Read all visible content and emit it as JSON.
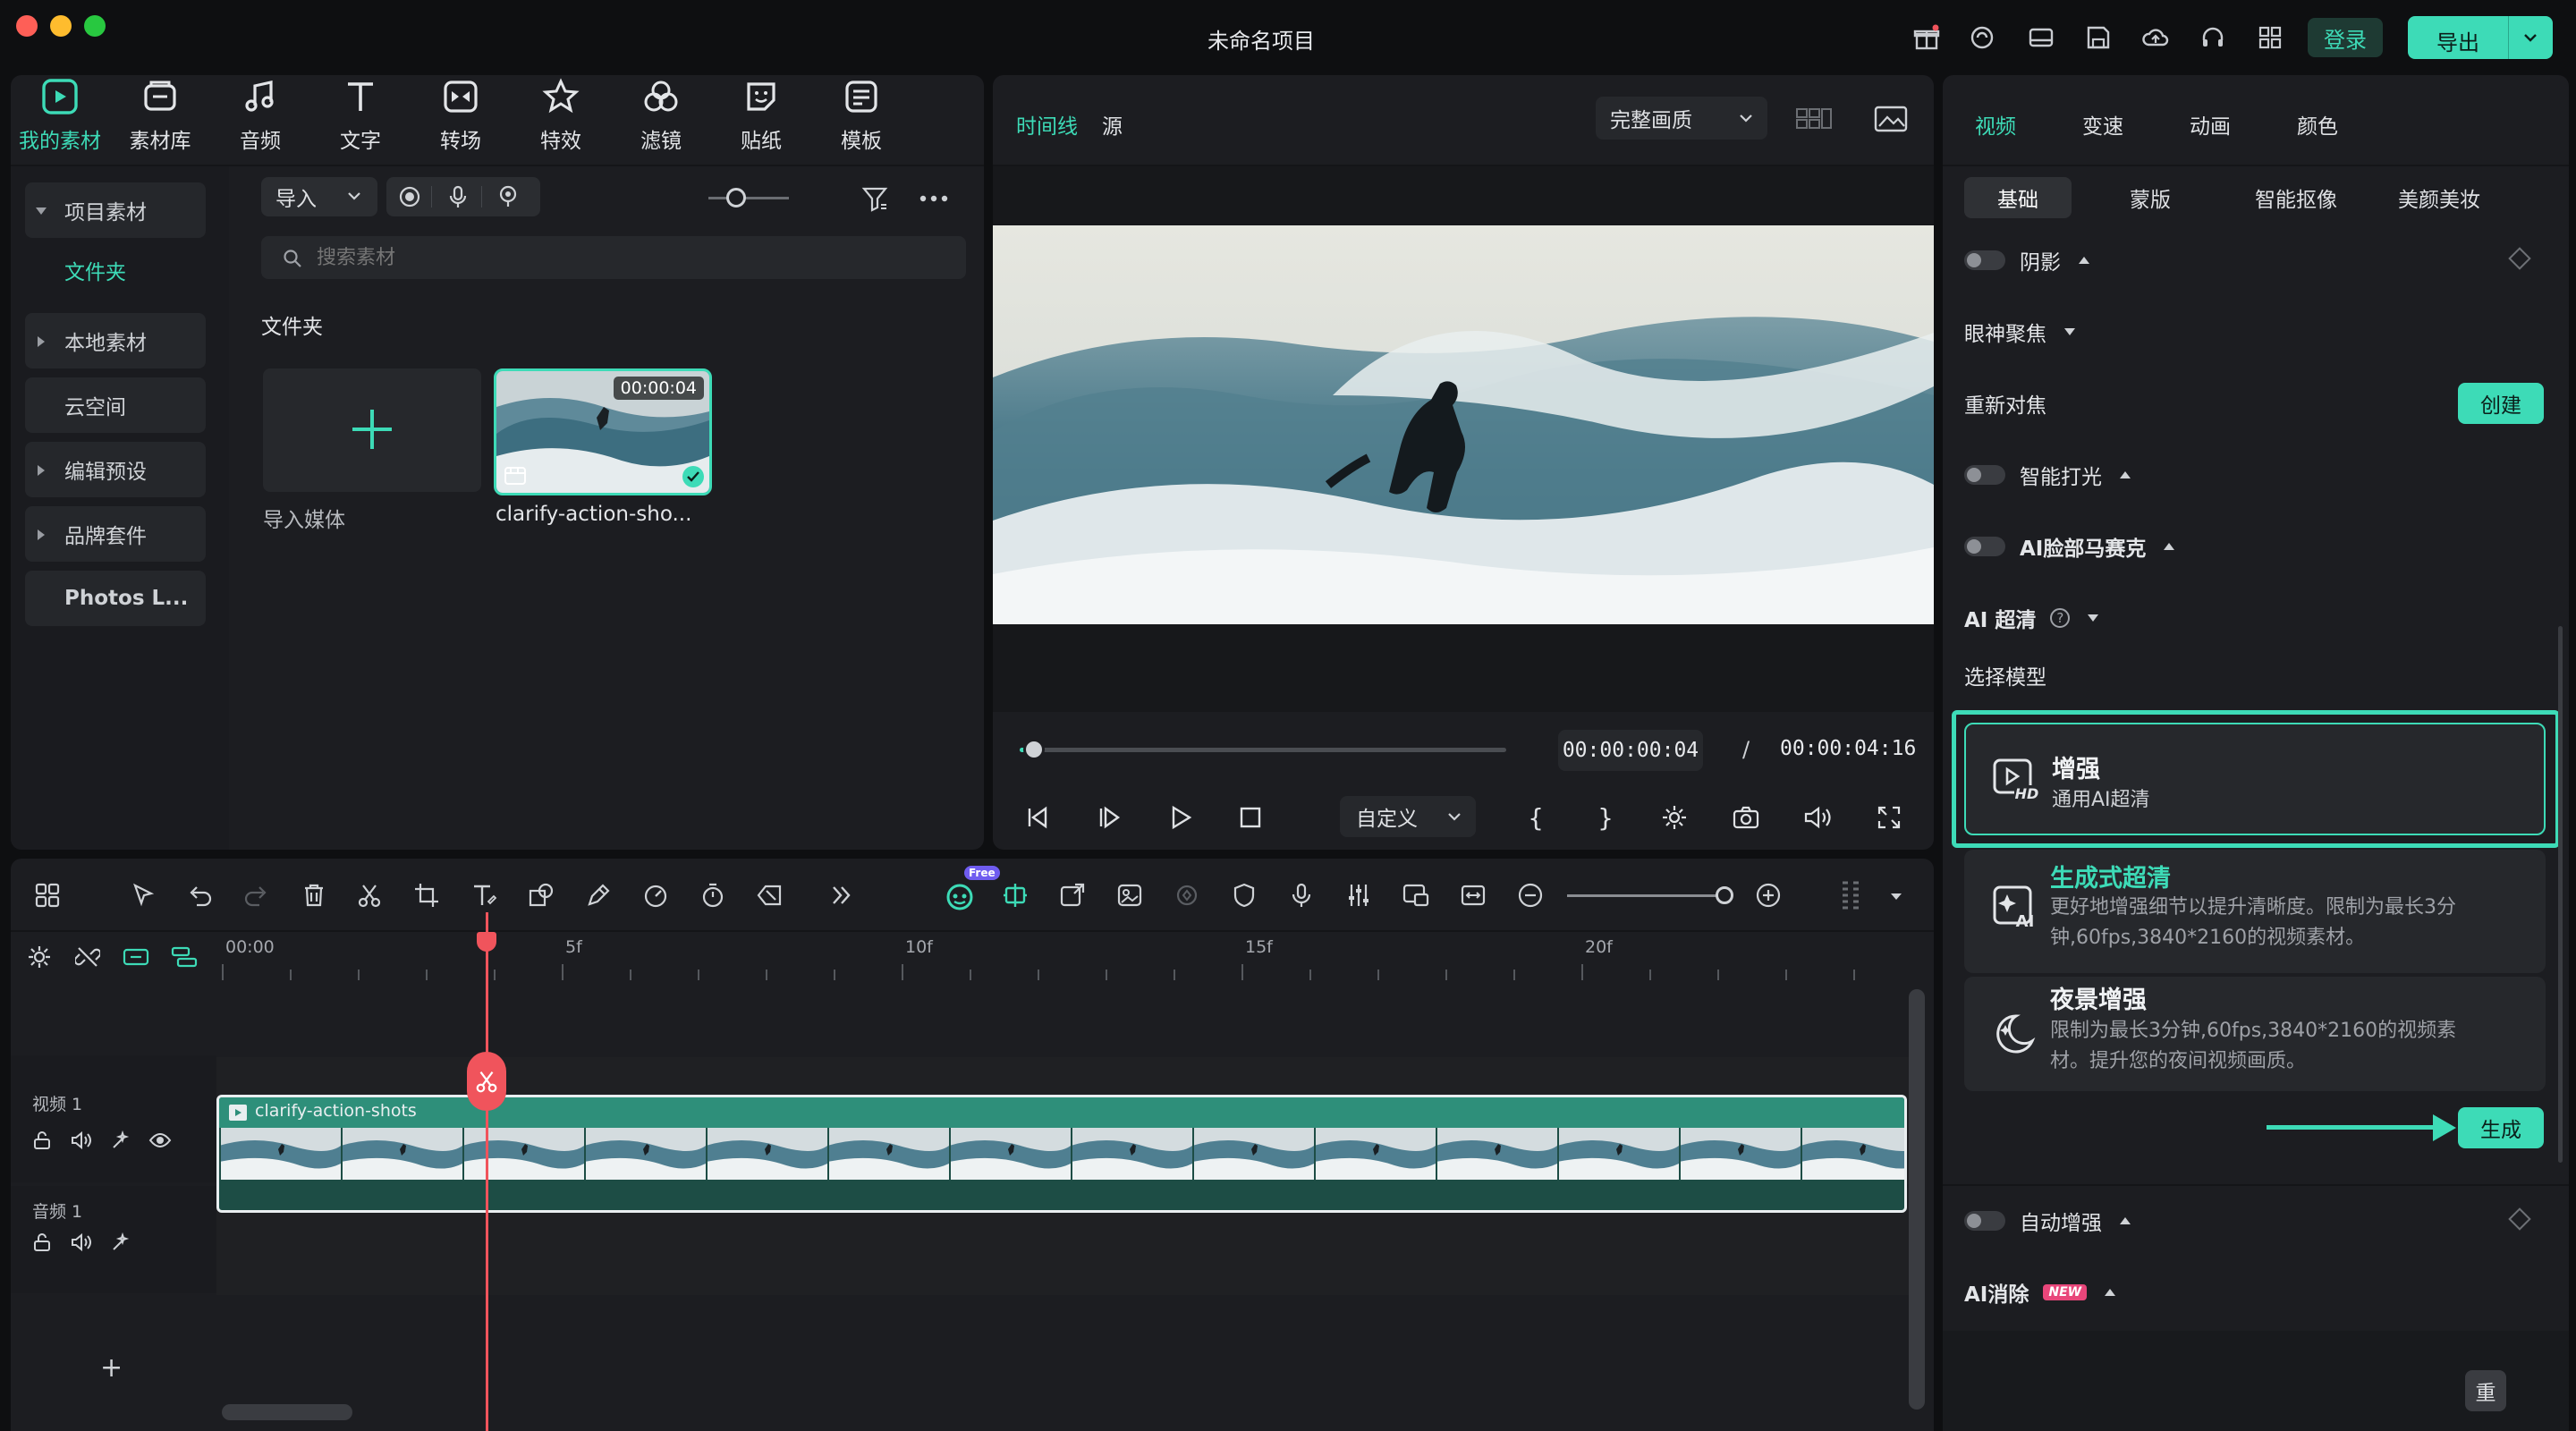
{
  "window": {
    "title": "未命名项目"
  },
  "titlebar": {
    "login_label": "登录",
    "export_label": "导出"
  },
  "nav": [
    {
      "label": "我的素材",
      "icon": "media-icon",
      "active": true
    },
    {
      "label": "素材库",
      "icon": "stock-library-icon"
    },
    {
      "label": "音频",
      "icon": "music-note-icon"
    },
    {
      "label": "文字",
      "icon": "text-t-icon"
    },
    {
      "label": "转场",
      "icon": "transition-icon"
    },
    {
      "label": "特效",
      "icon": "effects-star-icon"
    },
    {
      "label": "滤镜",
      "icon": "filter-icon"
    },
    {
      "label": "贴纸",
      "icon": "sticker-icon"
    },
    {
      "label": "模板",
      "icon": "template-icon"
    }
  ],
  "sidebar": {
    "items": [
      {
        "label": "项目素材",
        "expanded": true
      },
      {
        "label": "文件夹",
        "active": true
      },
      {
        "label": "本地素材"
      },
      {
        "label": "云空间"
      },
      {
        "label": "编辑预设"
      },
      {
        "label": "品牌套件"
      },
      {
        "label": "Photos L..."
      }
    ]
  },
  "library": {
    "import_label": "导入",
    "search_placeholder": "搜索素材",
    "folder_heading": "文件夹",
    "import_media_label": "导入媒体",
    "clip": {
      "name": "clarify-action-sho...",
      "duration": "00:00:04"
    }
  },
  "player": {
    "tab_timeline": "时间线",
    "tab_source": "源",
    "quality_label": "完整画质",
    "current_time": "00:00:00:04",
    "separator": "/",
    "total_time": "00:00:04:16",
    "custom_label": "自定义",
    "progress": 0.03
  },
  "props": {
    "tabs": [
      "视频",
      "变速",
      "动画",
      "颜色"
    ],
    "subtabs": [
      "基础",
      "蒙版",
      "智能抠像",
      "美颜美妆"
    ],
    "shadow_label": "阴影",
    "eye_focus_label": "眼神聚焦",
    "refocus_label": "重新对焦",
    "create_label": "创建",
    "smart_light_label": "智能打光",
    "ai_face_mosaic_label": "AI脸部马赛克",
    "ai_hd_label": "AI 超清",
    "choose_model_label": "选择模型",
    "models": [
      {
        "title": "增强",
        "desc": "通用AI超清",
        "icon": "hd-enhance-icon"
      },
      {
        "title": "生成式超清",
        "desc": "更好地增强细节以提升清晰度。限制为最长3分钟,60fps,3840*2160的视频素材。",
        "icon": "ai-generate-icon"
      },
      {
        "title": "夜景增强",
        "desc": "限制为最长3分钟,60fps,3840*2160的视频素材。提升您的夜间视频画质。",
        "icon": "night-moon-icon"
      }
    ],
    "generate_label": "生成",
    "auto_enhance_label": "自动增强",
    "ai_remove_label": "AI消除",
    "new_badge": "NEW",
    "reset_label": "重"
  },
  "timeline": {
    "ruler": [
      "00:00",
      "5f",
      "10f",
      "15f",
      "20f"
    ],
    "video_track_label": "视频 1",
    "audio_track_label": "音频 1",
    "clip_name": "clarify-action-shots",
    "free_badge": "Free",
    "add_track": "+"
  },
  "colors": {
    "accent": "#3ddbb7",
    "playhead": "#f0545c",
    "panel": "#1c1d21",
    "clip": "#2e8f7a"
  }
}
